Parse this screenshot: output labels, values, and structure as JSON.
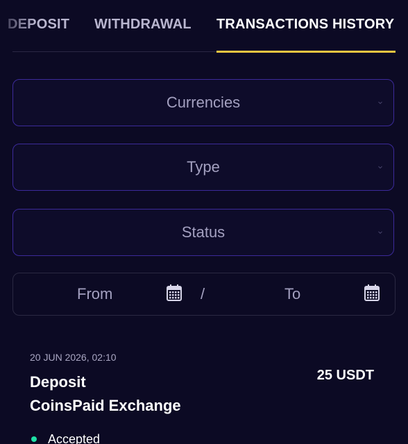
{
  "tabs": [
    {
      "label": "DEPOSIT",
      "active": false
    },
    {
      "label": "WITHDRAWAL",
      "active": false
    },
    {
      "label": "TRANSACTIONS HISTORY",
      "active": true
    }
  ],
  "filters": {
    "currencies": "Currencies",
    "type": "Type",
    "status": "Status"
  },
  "date_range": {
    "from": "From",
    "separator": "/",
    "to": "To"
  },
  "transaction": {
    "date": "20 JUN 2026, 02:10",
    "type": "Deposit",
    "method": "CoinsPaid Exchange",
    "amount": "25 USDT",
    "status": "Accepted",
    "status_color": "#1ee0a6"
  },
  "colors": {
    "background": "#0c0a24",
    "accent": "#f3c641",
    "border": "#3c2a9a"
  },
  "icons": [
    "chevron-down-icon",
    "calendar-icon"
  ]
}
